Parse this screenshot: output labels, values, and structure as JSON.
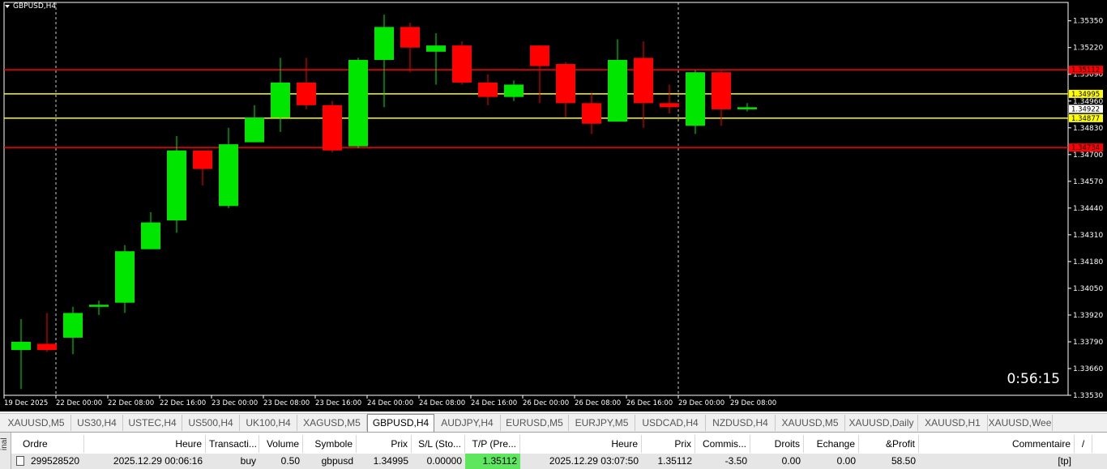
{
  "chart": {
    "symbol": "GBPUSD,H4",
    "countdown": "0:56:15",
    "colors": {
      "background": "#000000",
      "bull": "#00e600",
      "bear": "#ff0000",
      "axis_text": "#ffffff",
      "support_resistance_red": "#ff0000",
      "level_yellow": "#ffff00"
    },
    "price_axis": [
      "1.35350",
      "1.35220",
      "1.35090",
      "1.34960",
      "1.34830",
      "1.34700",
      "1.34570",
      "1.34440",
      "1.34310",
      "1.34180",
      "1.34050",
      "1.33920",
      "1.33790",
      "1.33660",
      "1.33530"
    ],
    "time_axis": [
      "19 Dec 2025",
      "22 Dec 00:00",
      "22 Dec 08:00",
      "22 Dec 16:00",
      "23 Dec 00:00",
      "23 Dec 08:00",
      "23 Dec 16:00",
      "24 Dec 00:00",
      "24 Dec 08:00",
      "24 Dec 16:00",
      "26 Dec 00:00",
      "26 Dec 08:00",
      "26 Dec 16:00",
      "29 Dec 00:00",
      "29 Dec 08:00"
    ],
    "horizontal_levels": [
      {
        "price": 1.35112,
        "label": "1.35112",
        "color": "#ff0000"
      },
      {
        "price": 1.34995,
        "label": "1.34995",
        "color": "#ffff00"
      },
      {
        "price": 1.34877,
        "label": "1.34877",
        "color": "#ffff00"
      },
      {
        "price": 1.34734,
        "label": "1.34734",
        "color": "#ff0000"
      }
    ],
    "current_price": "1.34922"
  },
  "chart_data": {
    "type": "candlestick",
    "title": "GBPUSD,H4",
    "ylim": [
      1.3353,
      1.354
    ],
    "candles": [
      {
        "o": 1.3375,
        "h": 1.339,
        "l": 1.3356,
        "c": 1.3379
      },
      {
        "o": 1.3378,
        "h": 1.3393,
        "l": 1.3374,
        "c": 1.3375
      },
      {
        "o": 1.3381,
        "h": 1.3396,
        "l": 1.3373,
        "c": 1.3393
      },
      {
        "o": 1.3396,
        "h": 1.3399,
        "l": 1.3392,
        "c": 1.3397
      },
      {
        "o": 1.3398,
        "h": 1.3426,
        "l": 1.3393,
        "c": 1.3423
      },
      {
        "o": 1.3424,
        "h": 1.3442,
        "l": 1.3424,
        "c": 1.3437
      },
      {
        "o": 1.3438,
        "h": 1.3479,
        "l": 1.3432,
        "c": 1.3472
      },
      {
        "o": 1.3472,
        "h": 1.3472,
        "l": 1.3455,
        "c": 1.3463
      },
      {
        "o": 1.3445,
        "h": 1.3483,
        "l": 1.3444,
        "c": 1.3475
      },
      {
        "o": 1.3476,
        "h": 1.3494,
        "l": 1.3476,
        "c": 1.3488
      },
      {
        "o": 1.3488,
        "h": 1.3517,
        "l": 1.3481,
        "c": 1.3505
      },
      {
        "o": 1.3505,
        "h": 1.3517,
        "l": 1.3492,
        "c": 1.3494
      },
      {
        "o": 1.3494,
        "h": 1.3496,
        "l": 1.3471,
        "c": 1.3472
      },
      {
        "o": 1.3474,
        "h": 1.3517,
        "l": 1.3473,
        "c": 1.3516
      },
      {
        "o": 1.3516,
        "h": 1.3538,
        "l": 1.3493,
        "c": 1.3532
      },
      {
        "o": 1.3532,
        "h": 1.3534,
        "l": 1.351,
        "c": 1.3522
      },
      {
        "o": 1.352,
        "h": 1.3529,
        "l": 1.3504,
        "c": 1.3523
      },
      {
        "o": 1.3523,
        "h": 1.3525,
        "l": 1.3504,
        "c": 1.3505
      },
      {
        "o": 1.3505,
        "h": 1.3509,
        "l": 1.3494,
        "c": 1.3498
      },
      {
        "o": 1.3498,
        "h": 1.3506,
        "l": 1.3496,
        "c": 1.3504
      },
      {
        "o": 1.3523,
        "h": 1.3523,
        "l": 1.3495,
        "c": 1.3513
      },
      {
        "o": 1.3514,
        "h": 1.3515,
        "l": 1.3488,
        "c": 1.3495
      },
      {
        "o": 1.3495,
        "h": 1.35,
        "l": 1.348,
        "c": 1.3485
      },
      {
        "o": 1.3486,
        "h": 1.3526,
        "l": 1.3486,
        "c": 1.3516
      },
      {
        "o": 1.3517,
        "h": 1.3525,
        "l": 1.3483,
        "c": 1.3495
      },
      {
        "o": 1.3495,
        "h": 1.3504,
        "l": 1.349,
        "c": 1.3493
      },
      {
        "o": 1.3484,
        "h": 1.3511,
        "l": 1.348,
        "c": 1.351
      },
      {
        "o": 1.351,
        "h": 1.3511,
        "l": 1.3484,
        "c": 1.3492
      },
      {
        "o": 1.3492,
        "h": 1.3495,
        "l": 1.3491,
        "c": 1.3493
      }
    ]
  },
  "tabs": [
    {
      "label": "XAUUSD,M5"
    },
    {
      "label": "US30,H4"
    },
    {
      "label": "USTEC,H4"
    },
    {
      "label": "US500,H4"
    },
    {
      "label": "UK100,H4"
    },
    {
      "label": "XAGUSD,M5"
    },
    {
      "label": "GBPUSD,H4",
      "active": true
    },
    {
      "label": "AUDJPY,H4"
    },
    {
      "label": "EURUSD,M5"
    },
    {
      "label": "EURJPY,M5"
    },
    {
      "label": "USDCAD,H4"
    },
    {
      "label": "NZDUSD,H4"
    },
    {
      "label": "XAUUSD,M5"
    },
    {
      "label": "XAUUSD,Daily"
    },
    {
      "label": "XAUUSD,H1"
    },
    {
      "label": "XAUUSD,Wee"
    }
  ],
  "trade_panel": {
    "side_label": "inal",
    "headers": [
      "Ordre",
      "Heure",
      "Transacti...",
      "Volume",
      "Symbole",
      "Prix",
      "S/L (Sto...",
      "T/P (Pre...",
      "Heure",
      "Prix",
      "Commis...",
      "Droits",
      "Echange",
      "&Profit",
      "Commentaire",
      "/"
    ],
    "row": {
      "ordre": "299528520",
      "heure": "2025.12.29 00:06:16",
      "transaction": "buy",
      "volume": "0.50",
      "symbole": "gbpusd",
      "prix": "1.34995",
      "sl": "0.00000",
      "tp": "1.35112",
      "heure2": "2025.12.29 03:07:50",
      "prix2": "1.35112",
      "commission": "-3.50",
      "droits": "0.00",
      "echange": "0.00",
      "profit": "58.50",
      "commentaire": "[tp]"
    },
    "tp_highlight": "#5ee65e"
  }
}
